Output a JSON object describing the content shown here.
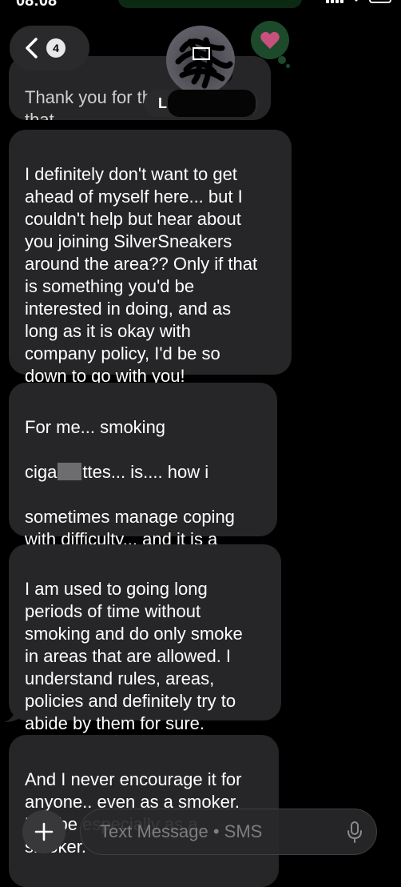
{
  "status_bar": {
    "time": "08:08"
  },
  "header": {
    "back_unread_count": "4",
    "contact_name": "L",
    "tapback": "heart-icon",
    "accent_color": "#1d4a2a"
  },
  "messages": [
    {
      "text": "Thank you for the ... on\nthat....",
      "partial": true
    },
    {
      "text": "I definitely don't want to get\nahead of myself here... but I\ncouldn't help but hear about\nyou joining SilverSneakers\naround the area?? Only if that\nis something you'd be\ninterested in doing, and as\nlong as it is okay with\ncompany policy, I'd be so\ndown to go with you!"
    },
    {
      "line1": "For me... smoking",
      "line2_start": "ciga",
      "line2_end": "ttes... is.... how i",
      "rest": "sometimes manage coping\nwith difficulty... and it is a\nterrible habit that is so hard\nfor me to break."
    },
    {
      "text": "I am used to going long\nperiods of time without\nsmoking and do only smoke\nin areas that are allowed. I\nunderstand rules, areas,\npolicies and definitely try to\nabide by them for sure."
    },
    {
      "text": "And I never encourage it for\nanyone.. even as a smoker.\nMaybe especially as a\nsmoker."
    }
  ],
  "compose": {
    "placeholder": "Text Message • SMS"
  },
  "colors": {
    "bubble_received": "#262628",
    "background": "#000000"
  }
}
